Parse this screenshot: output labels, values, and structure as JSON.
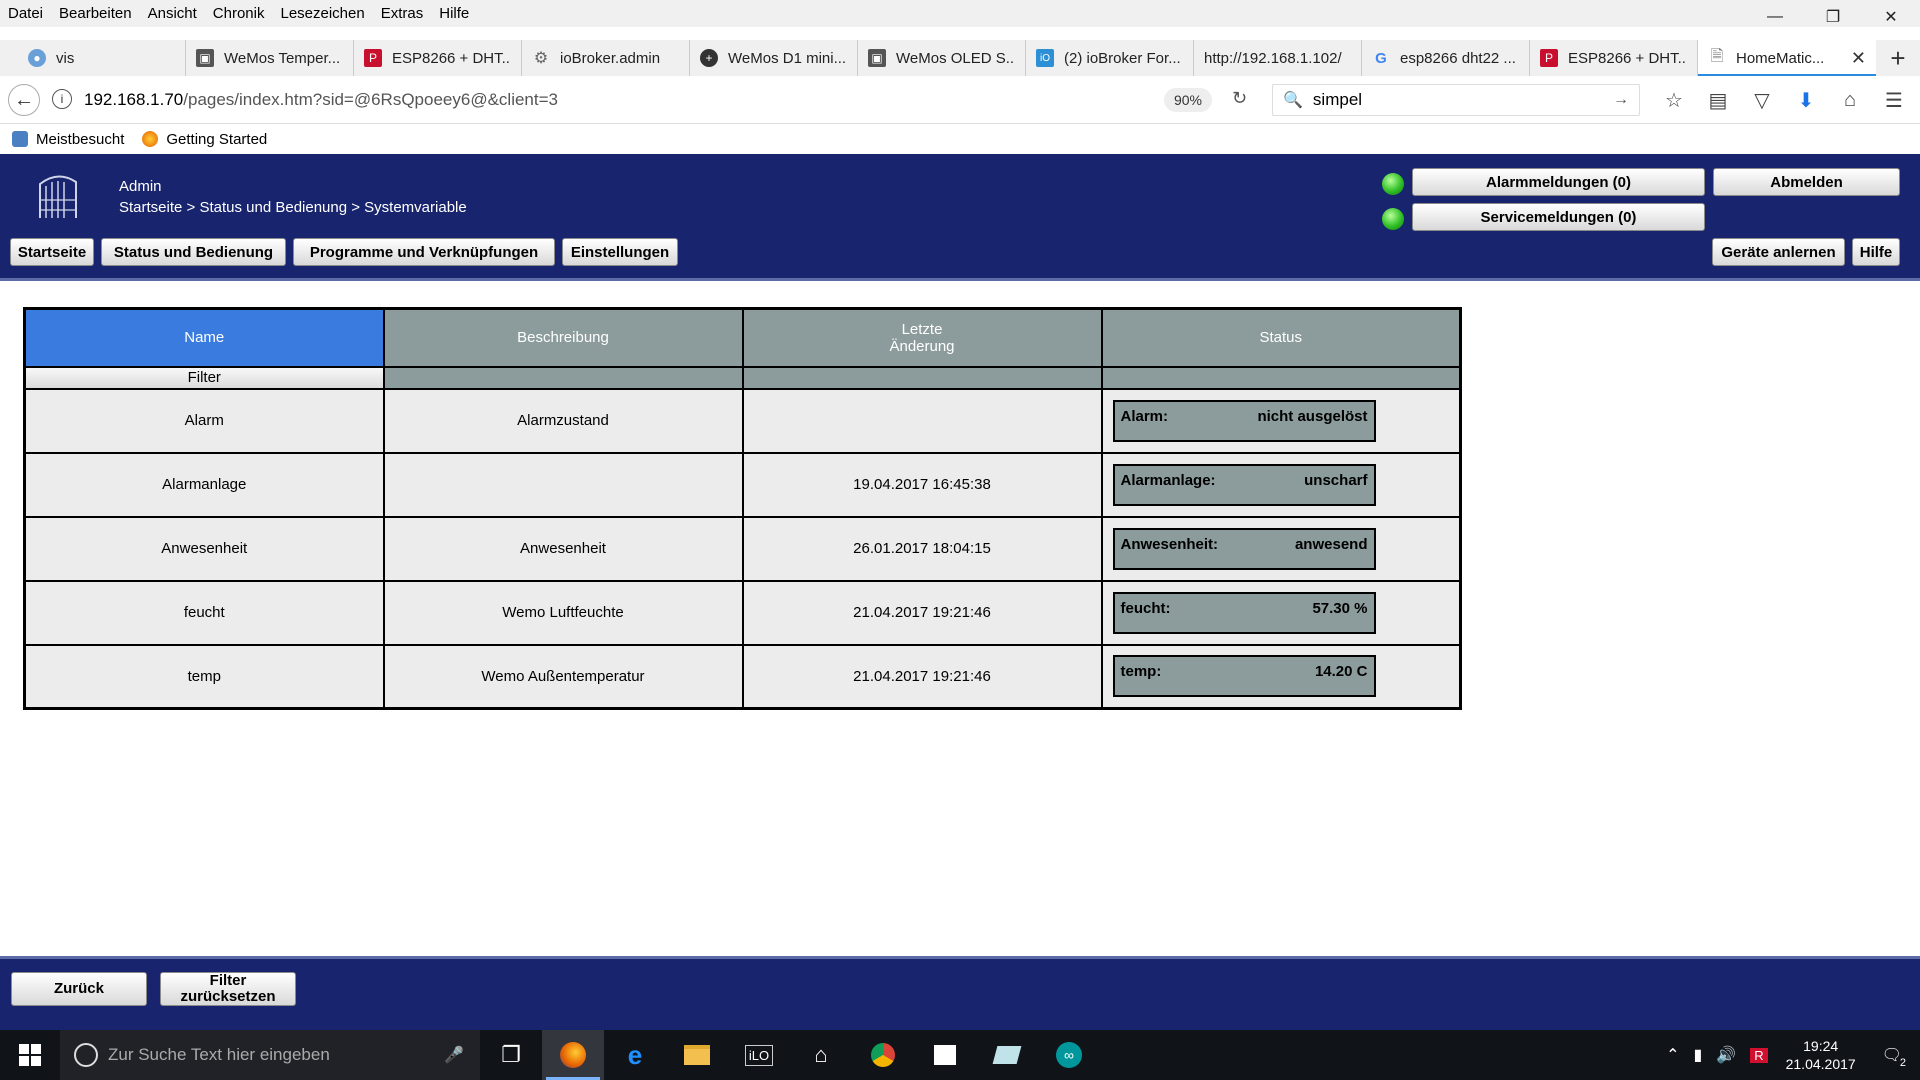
{
  "browser": {
    "menu": [
      "Datei",
      "Bearbeiten",
      "Ansicht",
      "Chronik",
      "Lesezeichen",
      "Extras",
      "Hilfe"
    ],
    "tabs": [
      {
        "label": "vis",
        "favicon_color": "#6aa0d8"
      },
      {
        "label": "WeMos Temper...",
        "favicon_color": "#555555"
      },
      {
        "label": "ESP8266 + DHT...",
        "favicon_color": "#c8102e"
      },
      {
        "label": "ioBroker.admin",
        "favicon_color": "#666666"
      },
      {
        "label": "WeMos D1 mini...",
        "favicon_color": "#333333"
      },
      {
        "label": "WeMos OLED S...",
        "favicon_color": "#555555"
      },
      {
        "label": "(2) ioBroker For...",
        "favicon_color": "#2d8fd5"
      },
      {
        "label": "http://192.168.1.102/",
        "favicon_color": ""
      },
      {
        "label": "esp8266 dht22 ...",
        "favicon_color": "#4285f4"
      },
      {
        "label": "ESP8266 + DHT...",
        "favicon_color": "#c8102e"
      },
      {
        "label": "HomeMatic...",
        "favicon_color": "#777777"
      }
    ],
    "url_host": "192.168.1.70",
    "url_path": "/pages/index.htm?sid=@6RsQpoeey6@&client=3",
    "zoom": "90%",
    "search_value": "simpel",
    "bookmarks": [
      "Meistbesucht",
      "Getting Started"
    ]
  },
  "homematic": {
    "user": "Admin",
    "breadcrumb": "Startseite > Status und Bedienung > Systemvariable",
    "alarm_button": "Alarmmeldungen (0)",
    "service_button": "Servicemeldungen (0)",
    "logout_button": "Abmelden",
    "nav": {
      "home": "Startseite",
      "status": "Status und Bedienung",
      "programs": "Programme und Verknüpfungen",
      "settings": "Einstellungen",
      "learn": "Geräte anlernen",
      "help": "Hilfe"
    },
    "table": {
      "headers": {
        "name": "Name",
        "description": "Beschreibung",
        "last_change_1": "Letzte",
        "last_change_2": "Änderung",
        "status": "Status"
      },
      "filter_label": "Filter",
      "rows": [
        {
          "name": "Alarm",
          "description": "Alarmzustand",
          "last_change": "",
          "status_label": "Alarm:",
          "status_value": "nicht ausgelöst"
        },
        {
          "name": "Alarmanlage",
          "description": "",
          "last_change": "19.04.2017 16:45:38",
          "status_label": "Alarmanlage:",
          "status_value": "unscharf"
        },
        {
          "name": "Anwesenheit",
          "description": "Anwesenheit",
          "last_change": "26.01.2017 18:04:15",
          "status_label": "Anwesenheit:",
          "status_value": "anwesend"
        },
        {
          "name": "feucht",
          "description": "Wemo Luftfeuchte",
          "last_change": "21.04.2017 19:21:46",
          "status_label": "feucht:",
          "status_value": "57.30 %"
        },
        {
          "name": "temp",
          "description": "Wemo Außentemperatur",
          "last_change": "21.04.2017 19:21:46",
          "status_label": "temp:",
          "status_value": "14.20 C"
        }
      ]
    },
    "footer": {
      "back": "Zurück",
      "reset_1": "Filter",
      "reset_2": "zurücksetzen"
    }
  },
  "taskbar": {
    "search_placeholder": "Zur Suche Text hier eingeben",
    "time": "19:24",
    "date": "21.04.2017",
    "notification_count": "2"
  },
  "colors": {
    "header_bg": "#18246e",
    "selected_header": "#3a7be0",
    "header_grey": "#8c9b9b",
    "led_green": "#2fbf26"
  }
}
